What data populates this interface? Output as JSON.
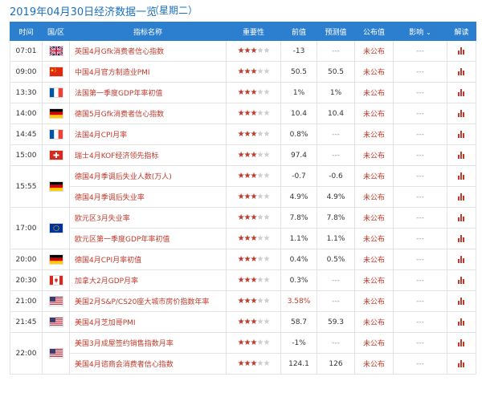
{
  "header": {
    "title": "2019年04月30日经济数据一览",
    "weekday": "（星期二）"
  },
  "columns": [
    "时间",
    "国/区",
    "指标名称",
    "重要性",
    "前值",
    "预测值",
    "公布值",
    "影响",
    "解读"
  ],
  "impact_chevron": "⌄",
  "groups": [
    {
      "time": "07:01",
      "flag": "uk",
      "rows": [
        {
          "name": "英国4月Gfk消费者信心指数",
          "stars": 3,
          "prev": "-13",
          "prev_red": false,
          "forecast": "---",
          "actual": "未公布",
          "impact": "---"
        }
      ]
    },
    {
      "time": "09:00",
      "flag": "cn",
      "rows": [
        {
          "name": "中国4月官方制造业PMI",
          "stars": 3,
          "prev": "50.5",
          "prev_red": false,
          "forecast": "50.5",
          "actual": "未公布",
          "impact": "---"
        }
      ]
    },
    {
      "time": "13:30",
      "flag": "fr",
      "rows": [
        {
          "name": "法国第一季度GDP年率初值",
          "stars": 3,
          "prev": "1%",
          "prev_red": false,
          "forecast": "1%",
          "actual": "未公布",
          "impact": "---"
        }
      ]
    },
    {
      "time": "14:00",
      "flag": "de",
      "rows": [
        {
          "name": "德国5月Gfk消费者信心指数",
          "stars": 3,
          "prev": "10.4",
          "prev_red": false,
          "forecast": "10.4",
          "actual": "未公布",
          "impact": "---"
        }
      ]
    },
    {
      "time": "14:45",
      "flag": "fr",
      "rows": [
        {
          "name": "法国4月CPI月率",
          "stars": 3,
          "prev": "0.8%",
          "prev_red": false,
          "forecast": "---",
          "actual": "未公布",
          "impact": "---"
        }
      ]
    },
    {
      "time": "15:00",
      "flag": "ch",
      "rows": [
        {
          "name": "瑞士4月KOF经济领先指标",
          "stars": 3,
          "prev": "97.4",
          "prev_red": false,
          "forecast": "---",
          "actual": "未公布",
          "impact": "---"
        }
      ]
    },
    {
      "time": "15:55",
      "flag": "de",
      "rows": [
        {
          "name": "德国4月季调后失业人数(万人)",
          "stars": 3,
          "prev": "-0.7",
          "prev_red": false,
          "forecast": "-0.6",
          "actual": "未公布",
          "impact": "---"
        },
        {
          "name": "德国4月季调后失业率",
          "stars": 3,
          "prev": "4.9%",
          "prev_red": false,
          "forecast": "4.9%",
          "actual": "未公布",
          "impact": "---"
        }
      ]
    },
    {
      "time": "17:00",
      "flag": "eu",
      "rows": [
        {
          "name": "欧元区3月失业率",
          "stars": 3,
          "prev": "7.8%",
          "prev_red": false,
          "forecast": "7.8%",
          "actual": "未公布",
          "impact": "---"
        },
        {
          "name": "欧元区第一季度GDP年率初值",
          "stars": 3,
          "prev": "1.1%",
          "prev_red": false,
          "forecast": "1.1%",
          "actual": "未公布",
          "impact": "---"
        }
      ]
    },
    {
      "time": "20:00",
      "flag": "de",
      "rows": [
        {
          "name": "德国4月CPI月率初值",
          "stars": 3,
          "prev": "0.4%",
          "prev_red": false,
          "forecast": "0.5%",
          "actual": "未公布",
          "impact": "---"
        }
      ]
    },
    {
      "time": "20:30",
      "flag": "ca",
      "rows": [
        {
          "name": "加拿大2月GDP月率",
          "stars": 3,
          "prev": "0.3%",
          "prev_red": false,
          "forecast": "---",
          "actual": "未公布",
          "impact": "---"
        }
      ]
    },
    {
      "time": "21:00",
      "flag": "us",
      "rows": [
        {
          "name": "美国2月S&P/CS20座大城市房价指数年率",
          "stars": 3,
          "prev": "3.58%",
          "prev_red": true,
          "forecast": "---",
          "actual": "未公布",
          "impact": "---"
        }
      ]
    },
    {
      "time": "21:45",
      "flag": "us",
      "rows": [
        {
          "name": "美国4月芝加哥PMI",
          "stars": 3,
          "prev": "58.7",
          "prev_red": false,
          "forecast": "59.3",
          "actual": "未公布",
          "impact": "---"
        }
      ]
    },
    {
      "time": "22:00",
      "flag": "us",
      "rows": [
        {
          "name": "美国3月成屋签约销售指数月率",
          "stars": 3,
          "prev": "-1%",
          "prev_red": false,
          "forecast": "---",
          "actual": "未公布",
          "impact": "---"
        },
        {
          "name": "美国4月谘商会消费者信心指数",
          "stars": 3,
          "prev": "124.1",
          "prev_red": false,
          "forecast": "126",
          "actual": "未公布",
          "impact": "---"
        }
      ]
    }
  ]
}
